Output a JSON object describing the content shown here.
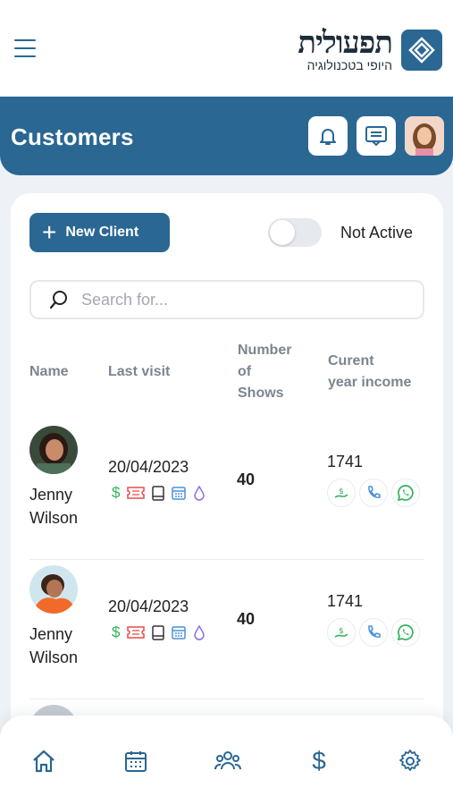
{
  "brand": {
    "name": "תפעולית",
    "tagline": "היופי בטכנולוגיה"
  },
  "header": {
    "title": "Customers"
  },
  "toolbar": {
    "new_client_label": "New Client",
    "not_active_label": "Not Active",
    "not_active_on": false
  },
  "search": {
    "placeholder": "Search for...",
    "value": ""
  },
  "table": {
    "columns": {
      "name": "Name",
      "last_visit": "Last visit",
      "shows": [
        "Number",
        "of",
        "Shows"
      ],
      "income": [
        "Curent",
        "year income"
      ]
    },
    "rows": [
      {
        "first": "Jenny",
        "last": "Wilson",
        "last_visit": "20/04/2023",
        "shows": "40",
        "income": "1741"
      },
      {
        "first": "Jenny",
        "last": "Wilson",
        "last_visit": "20/04/2023",
        "shows": "40",
        "income": "1741"
      }
    ]
  },
  "row_icons": [
    "dollar-icon",
    "ticket-icon",
    "book-icon",
    "calendar-icon",
    "drop-icon"
  ],
  "row_actions": [
    "pay-icon",
    "phone-icon",
    "whatsapp-icon"
  ],
  "nav": [
    "home-icon",
    "calendar-icon",
    "team-icon",
    "dollar-icon",
    "settings-icon"
  ],
  "colors": {
    "primary": "#2a6793",
    "green": "#2fb35a",
    "red": "#e84c4c",
    "blue": "#4a90d9",
    "purple": "#8a6fe8"
  }
}
